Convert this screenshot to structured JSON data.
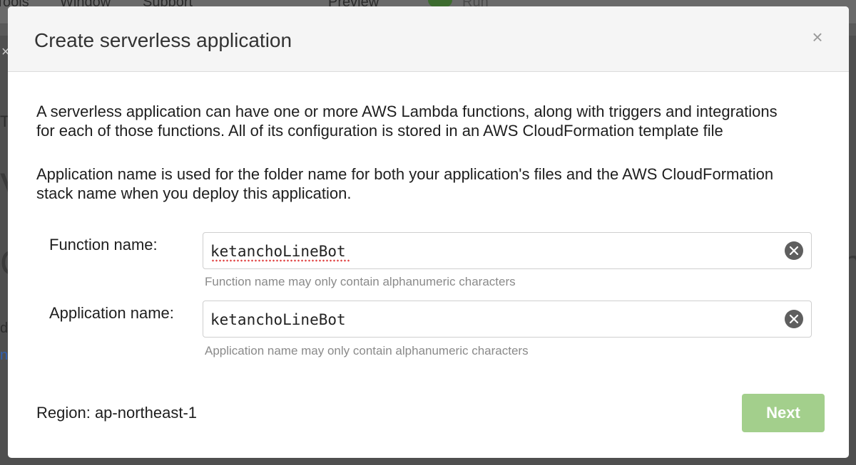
{
  "background": {
    "menu": [
      "Tools",
      "Window",
      "Support",
      "Preview",
      "Run"
    ],
    "fragments": [
      "T",
      "V",
      "C",
      "d",
      "n",
      "n"
    ]
  },
  "dialog": {
    "title": "Create serverless application",
    "close_icon": "close-icon",
    "description_1": "A serverless application can have one or more AWS Lambda functions, along with triggers and integrations for each of those functions. All of its configuration is stored in an AWS CloudFormation template file",
    "description_2": "Application name is used for the folder name for both your application's files and the AWS CloudFormation stack name when you deploy this application.",
    "function_field": {
      "label": "Function name:",
      "value": "ketanchoLineBot",
      "help": "Function name may only contain alphanumeric characters"
    },
    "application_field": {
      "label": "Application name:",
      "value": "ketanchoLineBot",
      "help": "Application name may only contain alphanumeric characters"
    },
    "region": "Region: ap-northeast-1",
    "next_label": "Next"
  },
  "colors": {
    "next_button": "#a3cf8c",
    "header_bg": "#f5f5f5",
    "overlay": "#5a5a5a"
  }
}
